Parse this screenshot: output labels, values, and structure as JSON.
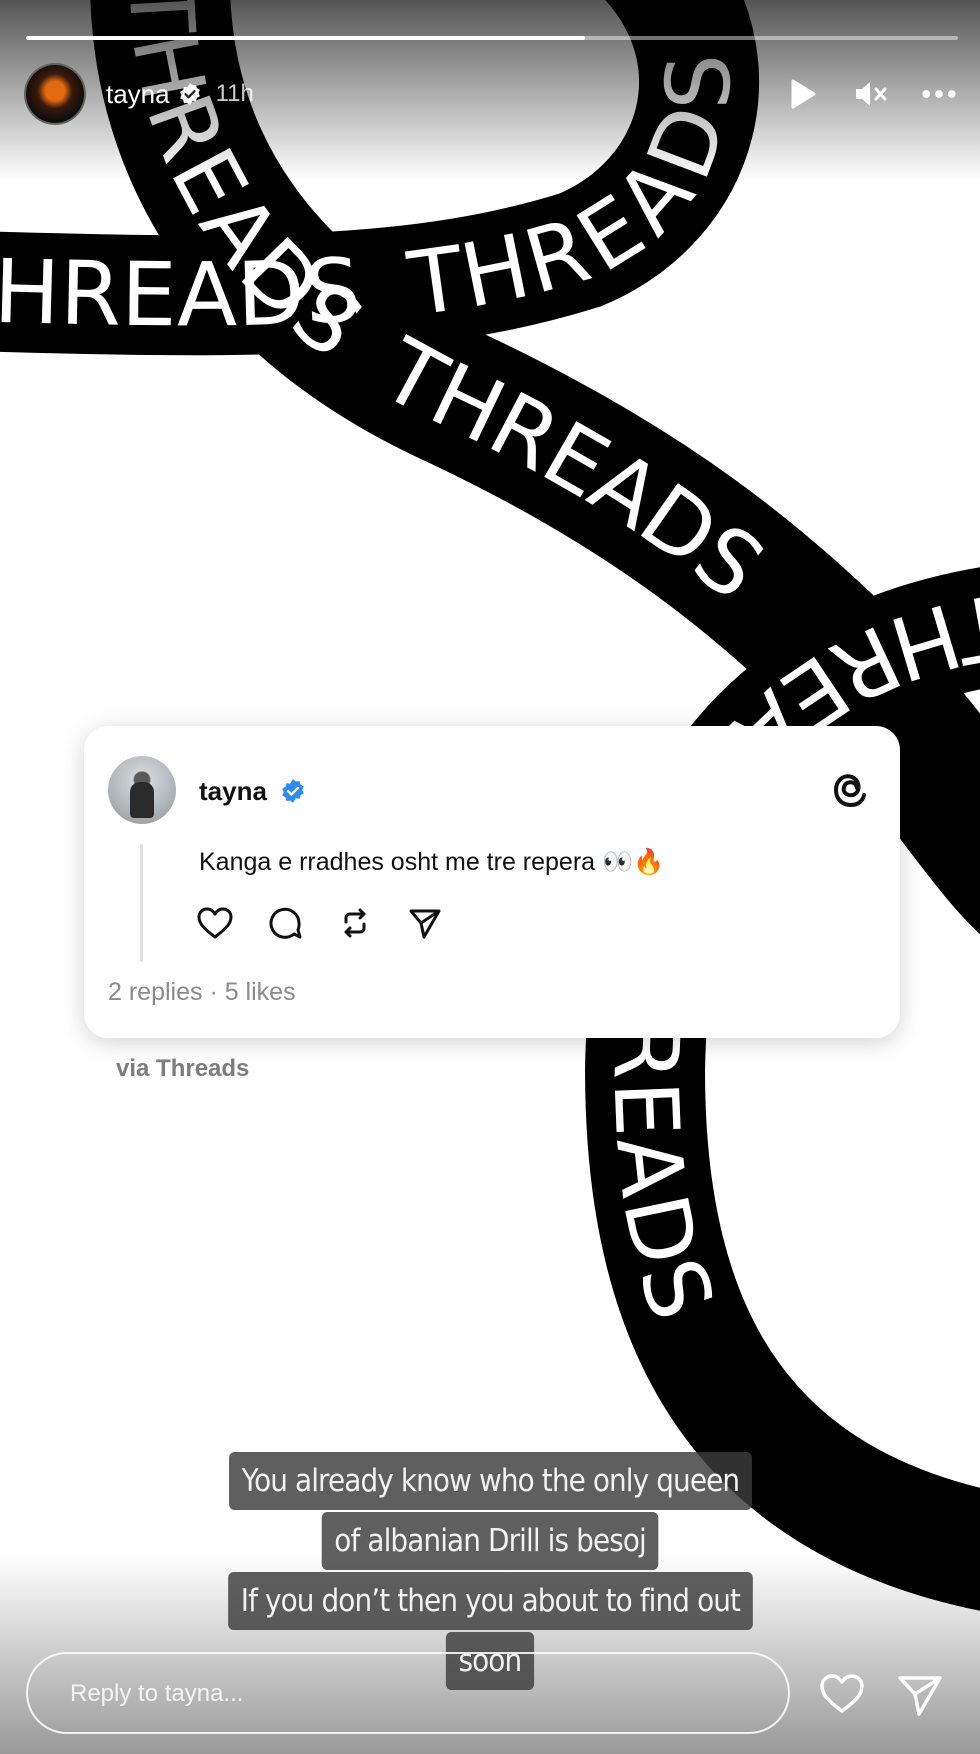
{
  "story": {
    "progress": 0.6,
    "username": "tayna",
    "time": "11h",
    "actions": [
      "play-icon",
      "mute-icon",
      "more-icon"
    ]
  },
  "background": {
    "ribbon_text": "THREADS",
    "ribbon_color": "#000000",
    "text_color": "#ffffff"
  },
  "post": {
    "username": "tayna",
    "text": "Kanga e rradhes osht me tre repera 👀🔥",
    "stats": "2 replies · 5 likes",
    "actions": [
      "like-icon",
      "comment-icon",
      "repost-icon",
      "share-icon"
    ],
    "verified_color": "#2f8cf0"
  },
  "via": "via Threads",
  "caption": {
    "lines": [
      "You already know who the only queen",
      "of albanian Drill is besoj",
      "If you don’t then you about to find out",
      "soon"
    ]
  },
  "reply": {
    "placeholder": "Reply to tayna..."
  }
}
